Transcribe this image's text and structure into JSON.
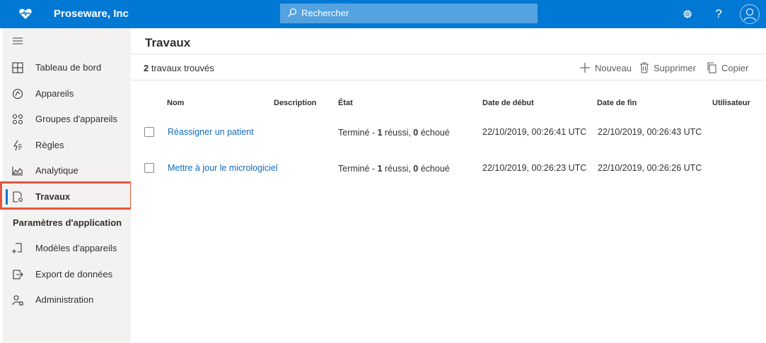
{
  "app": {
    "brand_name": "Proseware, Inc",
    "search_placeholder": "Rechercher",
    "accent_color": "#0078d4"
  },
  "sidebar": {
    "items": [
      {
        "label": "Tableau de bord",
        "icon": "dashboard-icon"
      },
      {
        "label": "Appareils",
        "icon": "devices-icon"
      },
      {
        "label": "Groupes d'appareils",
        "icon": "device-groups-icon"
      },
      {
        "label": "Règles",
        "icon": "rules-icon"
      },
      {
        "label": "Analytique",
        "icon": "analytics-icon"
      },
      {
        "label": "Travaux",
        "icon": "jobs-icon",
        "active": true
      }
    ],
    "section_header": "Paramètres d'application",
    "settings_items": [
      {
        "label": "Modèles d'appareils",
        "icon": "device-templates-icon"
      },
      {
        "label": "Export de données",
        "icon": "data-export-icon"
      },
      {
        "label": "Administration",
        "icon": "administration-icon"
      }
    ]
  },
  "main": {
    "title": "Travaux",
    "count_number": "2",
    "count_text": "travaux trouvés",
    "commands": {
      "new": "Nouveau",
      "delete": "Supprimer",
      "copy": "Copier"
    },
    "columns": [
      "Nom",
      "Description",
      "État",
      "Date de début",
      "Date de fin",
      "Utilisateur"
    ],
    "rows": [
      {
        "name": "Réassigner un patient",
        "description": "",
        "state_prefix": "Terminé - ",
        "succeeded": "1",
        "succeeded_label": " réussi, ",
        "failed": "0",
        "failed_label": " échoué",
        "start": "22/10/2019, 00:26:41 UTC",
        "end": "22/10/2019, 00:26:43 UTC",
        "user": ""
      },
      {
        "name": "Mettre à jour le micrologiciel",
        "description": "",
        "state_prefix": "Terminé - ",
        "succeeded": "1",
        "succeeded_label": " réussi, ",
        "failed": "0",
        "failed_label": " échoué",
        "start": "22/10/2019, 00:26:23 UTC",
        "end": "22/10/2019, 00:26:26 UTC",
        "user": ""
      }
    ]
  }
}
